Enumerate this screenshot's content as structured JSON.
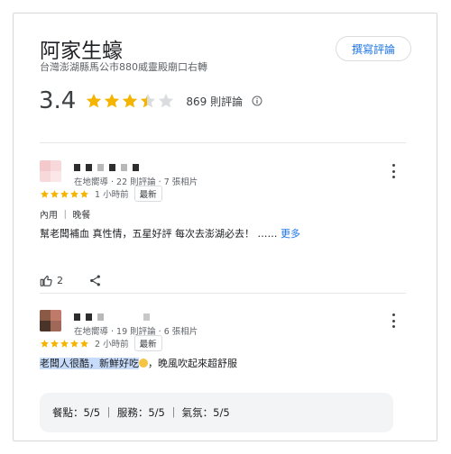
{
  "place": {
    "name": "阿家生蠔",
    "address": "台灣澎湖縣馬公市880威靈殿廟口右轉",
    "write_review_label": "撰寫評論",
    "rating": "3.4",
    "rating_value": 3.4,
    "review_count_label": "869 則評論"
  },
  "reviews": [
    {
      "author_meta": "在地嚮導 · 22 則評論 · 7 張相片",
      "stars": 5,
      "time": "1 小時前",
      "badge": "最新",
      "tag": "內用 ｜ 晚餐",
      "text": "幫老闆補血 真性情，五星好評 每次去澎湖必去！ ……",
      "more_label": "更多",
      "likes": "2"
    },
    {
      "author_meta": "在地嚮導 · 19 則評論 · 6 張相片",
      "stars": 5,
      "time": "2 小時前",
      "badge": "最新",
      "text_highlight": "老闆人很酷，新鮮好吃",
      "text_rest": "，晚風吹起來超舒服",
      "scores": "餐點：5/5 ｜ 服務：5/5 ｜ 氣氛：5/5"
    }
  ],
  "colors": {
    "star": "#f5b400",
    "star_empty": "#dadce0",
    "link": "#1a73e8"
  }
}
